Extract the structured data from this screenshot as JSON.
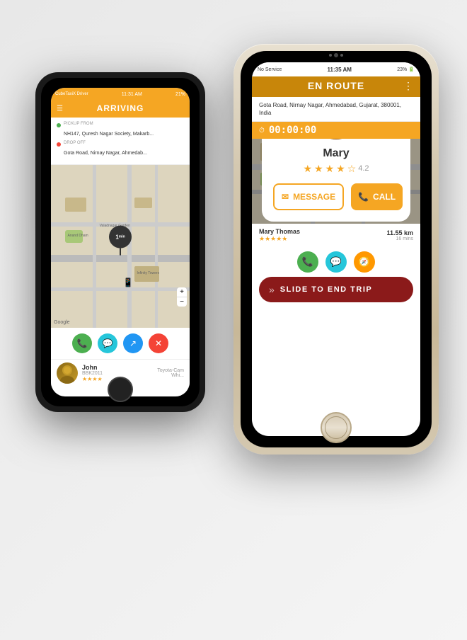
{
  "left_phone": {
    "status_bar": {
      "app_name": "CubeTaxiX Driver",
      "time": "11:31 AM",
      "battery": "21%"
    },
    "header": {
      "title": "ARRIVING",
      "menu_icon": "☰"
    },
    "trip": {
      "pickup_label": "PICKUP FROM",
      "pickup_address": "NH147, Quresh Nagar Society, Makarb...",
      "dropoff_label": "DROP OFF",
      "dropoff_address": "Gota Road, Nirnay Nagar, Ahmedab..."
    },
    "map": {
      "eta_label": "1",
      "eta_unit": "min",
      "google_label": "Google"
    },
    "actions": {
      "phone_icon": "📞",
      "chat_icon": "💬",
      "share_icon": "↗",
      "close_icon": "✕"
    },
    "driver": {
      "name": "John",
      "plate": "BBK2011",
      "car": "Toyota-Cam",
      "color": "Whi...",
      "stars": "★★★★"
    }
  },
  "right_phone": {
    "status_bar": {
      "signal": "No Service",
      "wifi": "wifi",
      "time": "11:35 AM",
      "battery": "23%"
    },
    "header": {
      "title": "EN ROUTE",
      "dots": "⋮"
    },
    "address": "Gota Road, Nirnay Nagar, Ahmedabad, Gujarat, 380001, India",
    "timer": "00:00:00",
    "modal": {
      "close_icon": "×",
      "name": "Mary",
      "rating": 4.2,
      "stars_filled": 4,
      "stars_half": 0,
      "stars_empty": 1,
      "message_btn": "MESSAGE",
      "call_btn": "CALL"
    },
    "passenger": {
      "name": "Mary Thomas",
      "stars": "★★★★★",
      "distance": "11.55 km",
      "time": "16 mins"
    },
    "slide_end": {
      "arrows": "»",
      "text": "SLIDE TO END TRIP"
    }
  }
}
